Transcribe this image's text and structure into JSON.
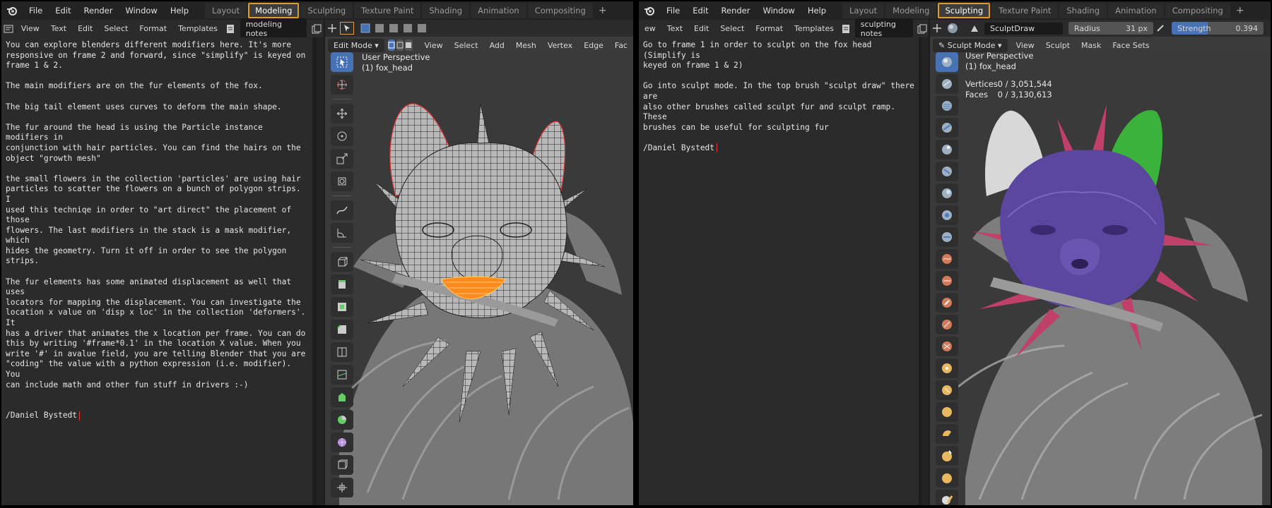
{
  "left": {
    "menu": [
      "File",
      "Edit",
      "Render",
      "Window",
      "Help"
    ],
    "workspaces": [
      "Layout",
      "Modeling",
      "Sculpting",
      "Texture Paint",
      "Shading",
      "Animation",
      "Compositing"
    ],
    "active_workspace": "Modeling",
    "text_menu": [
      "View",
      "Text",
      "Edit",
      "Select",
      "Format",
      "Templates"
    ],
    "text_name": "modeling notes",
    "text_paragraphs": [
      "You can explore blenders different modifiers here. It's more\nresponsive on frame 2 and forward, since \"simplify\" is keyed on\nframe 1 & 2.",
      "The main modifiers are on the fur elements of the fox.",
      "The big tail element uses curves to deform the main shape.",
      "The fur around the head is using the Particle instance modifiers in\nconjunction with hair particles. You can find the hairs on the\nobject \"growth mesh\"",
      "the small flowers in the collection 'particles' are using hair\nparticles to scatter the flowers on a bunch of polygon strips. I\nused this techniqe in order to \"art direct\" the placement of those\nflowers. The last modifiers in the stack is a mask modifier, which\nhides the geometry. Turn it off in order to see the polygon strips.",
      "The fur elements has some animated displacement as well that uses\nlocators for mapping the displacement. You can investigate the\nlocation x value on 'disp x loc' in the collection 'deformers'. It\nhas a driver that animates the x location per frame. You can do\nthis by writing '#frame*0.1' in the location X value. When you\nwrite '#' in avalue field, you are telling Blender that you are\n\"coding\" the value with a python expression (i.e. modifier). You\ncan include math and other fun stuff in drivers :-)"
    ],
    "signature": "/Daniel Bystedt",
    "viewport": {
      "mode": "Edit Mode",
      "menu": [
        "View",
        "Select",
        "Add",
        "Mesh",
        "Vertex",
        "Edge",
        "Fac"
      ],
      "perspective": "User Perspective",
      "object": "(1) fox_head"
    }
  },
  "right": {
    "menu": [
      "File",
      "Edit",
      "Render",
      "Window",
      "Help"
    ],
    "workspaces": [
      "Layout",
      "Modeling",
      "Sculpting",
      "Texture Paint",
      "Shading",
      "Animation",
      "Compositing"
    ],
    "active_workspace": "Sculpting",
    "text_menu": [
      "ew",
      "Text",
      "Edit",
      "Select",
      "Format",
      "Templates"
    ],
    "text_name": "sculpting notes",
    "text_paragraphs": [
      "Go to frame 1 in order to sculpt on the fox head (Simplify is\nkeyed on frame 1 & 2)",
      "Go into sculpt mode. In the top brush \"sculpt draw\" there are\nalso other brushes called sculpt fur and sculpt ramp. These\nbrushes can be useful for sculpting fur"
    ],
    "signature": "/Daniel Bystedt",
    "brush": {
      "name": "SculptDraw",
      "radius_label": "Radius",
      "radius_value": "31 px",
      "strength_label": "Strength",
      "strength_value": "0.394",
      "strength_fraction": 0.394
    },
    "viewport": {
      "mode": "Sculpt Mode",
      "menu": [
        "View",
        "Sculpt",
        "Mask",
        "Face Sets"
      ],
      "perspective": "User Perspective",
      "object": "(1) fox_head",
      "stats": [
        {
          "label": "Vertices",
          "value": "0 / 3,051,544"
        },
        {
          "label": "Faces",
          "value": "0 / 3,130,613"
        }
      ]
    }
  },
  "colors": {
    "accent_outline": "#e09a2e",
    "active_tool": "#4772b3",
    "purple_sculpt": "#5b46a0",
    "green_ear": "#3bb23b",
    "pink_fur": "#c0406a",
    "selected_orange": "#ff8a1e"
  },
  "icons": [
    "blender-logo-icon",
    "select-box-icon",
    "cursor-icon",
    "move-icon",
    "rotate-icon",
    "scale-icon",
    "transform-icon",
    "annotate-icon",
    "measure-icon",
    "extrude-icon",
    "inset-icon",
    "bevel-icon",
    "loop-cut-icon",
    "knife-icon",
    "poly-build-icon",
    "spin-icon",
    "smooth-icon",
    "shear-icon",
    "sculpt-brush-icon"
  ]
}
